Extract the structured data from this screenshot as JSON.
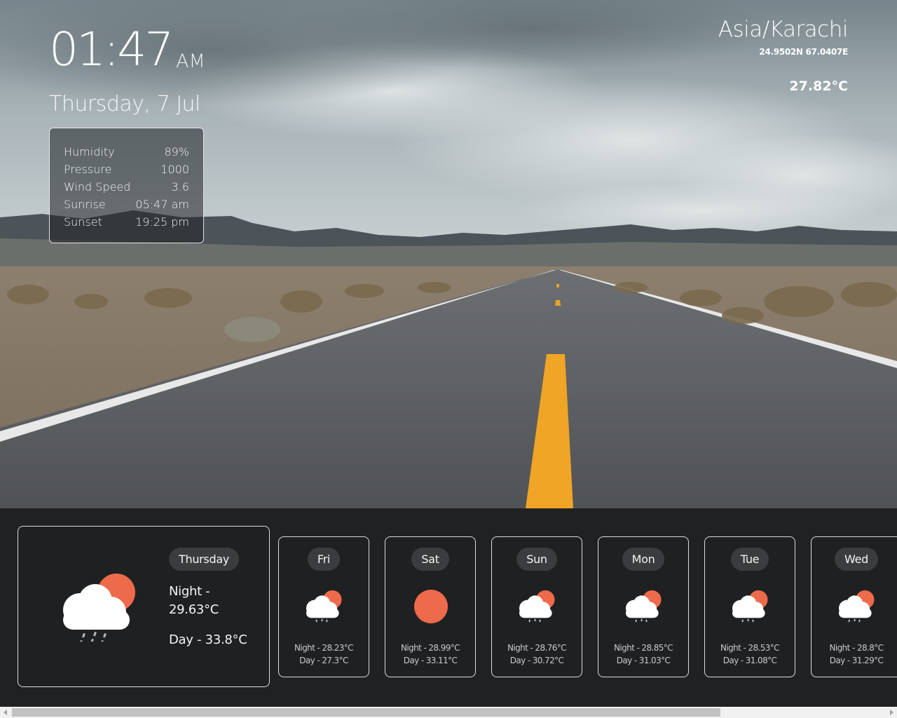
{
  "clock": {
    "time": "01:47",
    "ampm": "AM",
    "date": "Thursday, 7 Jul"
  },
  "stats": [
    {
      "label": "Humidity",
      "value": "89%"
    },
    {
      "label": "Pressure",
      "value": "1000"
    },
    {
      "label": "Wind Speed",
      "value": "3.6"
    },
    {
      "label": "Sunrise",
      "value": "05:47 am"
    },
    {
      "label": "Sunset",
      "value": "19:25 pm"
    }
  ],
  "location": {
    "timezone": "Asia/Karachi",
    "coords": "24.9502N 67.0407E",
    "temperature": "27.82°C"
  },
  "today": {
    "day": "Thursday",
    "night": "Night - 29.63°C",
    "day_temp": "Day - 33.8°C",
    "icon": "cloud-rain-sun-icon"
  },
  "forecast": [
    {
      "day": "Fri",
      "night": "Night - 28.23°C",
      "day_temp": "Day - 27.3°C",
      "icon": "cloud-rain-sun-icon"
    },
    {
      "day": "Sat",
      "night": "Night - 28.99°C",
      "day_temp": "Day - 33.11°C",
      "icon": "sun-icon"
    },
    {
      "day": "Sun",
      "night": "Night - 28.76°C",
      "day_temp": "Day - 30.72°C",
      "icon": "cloud-rain-sun-icon"
    },
    {
      "day": "Mon",
      "night": "Night - 28.85°C",
      "day_temp": "Day - 31.03°C",
      "icon": "cloud-rain-sun-icon"
    },
    {
      "day": "Tue",
      "night": "Night - 28.53°C",
      "day_temp": "Day - 31.08°C",
      "icon": "cloud-rain-sun-icon"
    },
    {
      "day": "Wed",
      "night": "Night - 28.8°C",
      "day_temp": "Day - 31.29°C",
      "icon": "cloud-rain-sun-icon"
    }
  ],
  "colors": {
    "sun": "#ed6a4a",
    "cloud": "#ffffff",
    "rain": "#b8b8b8",
    "panel": "#202123",
    "pill": "#3b3c40"
  }
}
